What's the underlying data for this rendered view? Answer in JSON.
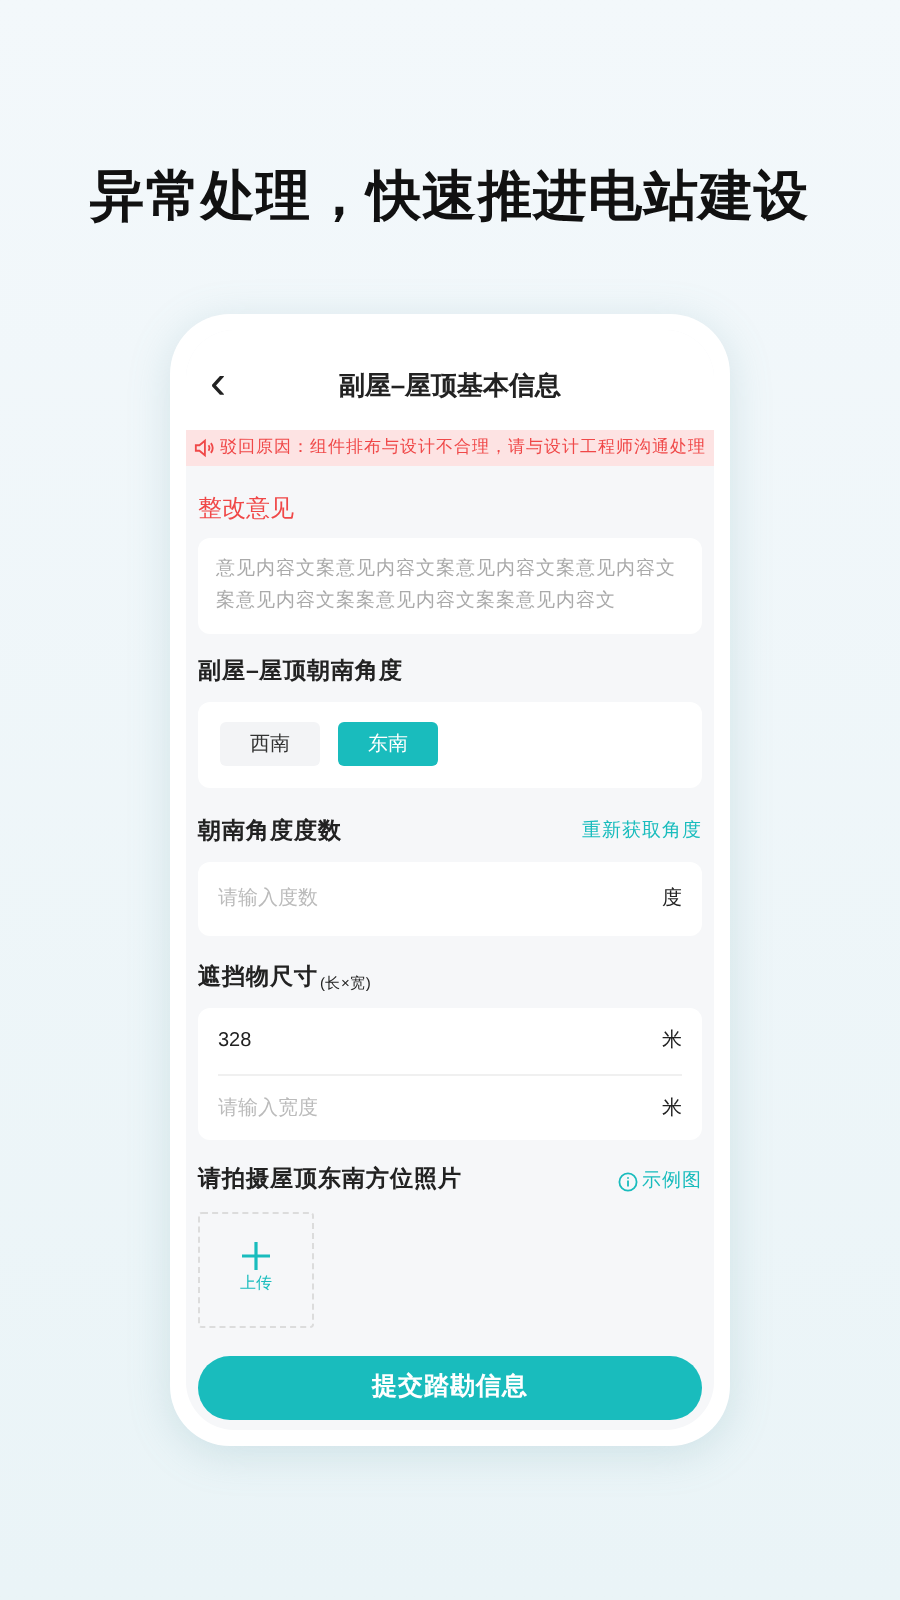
{
  "headline": "异常处理，快速推进电站建设",
  "nav": {
    "back": "‹",
    "title": "副屋–屋顶基本信息"
  },
  "alert": "驳回原因：组件排布与设计不合理，请与设计工程师沟通处理",
  "opinion": {
    "label": "整改意见",
    "text": "意见内容文案意见内容文案意见内容文案意见内容文案意见内容文案案意见内容文案案意见内容文"
  },
  "orientation": {
    "label": "副屋–屋顶朝南角度",
    "options": [
      {
        "label": "西南",
        "selected": false
      },
      {
        "label": "东南",
        "selected": true
      }
    ]
  },
  "angle": {
    "label": "朝南角度度数",
    "action": "重新获取角度",
    "placeholder": "请输入度数",
    "unit": "度"
  },
  "size": {
    "label": "遮挡物尺寸",
    "hint": "(长×宽)",
    "fields": [
      {
        "value": "328",
        "unit": "米"
      },
      {
        "placeholder": "请输入宽度",
        "unit": "米"
      }
    ]
  },
  "photo": {
    "label": "请拍摄屋顶东南方位照片",
    "example": "示例图",
    "upload": "上传"
  },
  "submit": "提交踏勘信息"
}
